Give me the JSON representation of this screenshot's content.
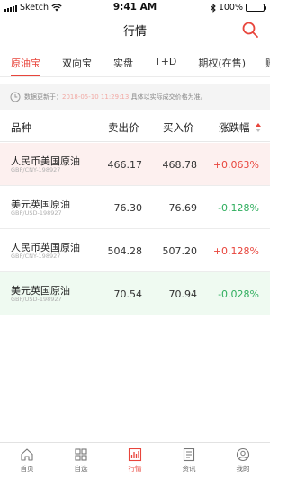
{
  "status_bar": {
    "carrier": "Sketch",
    "time": "9:41 AM",
    "battery": "100%"
  },
  "nav": {
    "title": "行情"
  },
  "tabs": [
    {
      "label": "原油宝",
      "active": true
    },
    {
      "label": "双向宝",
      "active": false
    },
    {
      "label": "实盘",
      "active": false
    },
    {
      "label": "T+D",
      "active": false
    },
    {
      "label": "期权(在售)",
      "active": false
    },
    {
      "label": "账",
      "active": false
    }
  ],
  "notice": {
    "prefix": "数据更新于：",
    "time": "2018-05-10 11:29:13,",
    "suffix": "具体以实际成交价格为准。"
  },
  "table": {
    "headers": {
      "name": "品种",
      "sell": "卖出价",
      "buy": "买入价",
      "change": "涨跌幅"
    },
    "rows": [
      {
        "name": "人民币美国原油",
        "code": "GBP/CNY-198927",
        "sell": "466.17",
        "buy": "468.78",
        "change": "+0.063%",
        "trend": "up"
      },
      {
        "name": "美元英国原油",
        "code": "GBP/USD-198927",
        "sell": "76.30",
        "buy": "76.69",
        "change": "-0.128%",
        "trend": "down"
      },
      {
        "name": "人民币英国原油",
        "code": "GBP/CNY-198927",
        "sell": "504.28",
        "buy": "507.20",
        "change": "+0.128%",
        "trend": "up"
      },
      {
        "name": "美元英国原油",
        "code": "GBP/USD-198927",
        "sell": "70.54",
        "buy": "70.94",
        "change": "-0.028%",
        "trend": "down"
      }
    ]
  },
  "bottom_nav": [
    {
      "label": "首页",
      "icon": "home-icon",
      "active": false
    },
    {
      "label": "自选",
      "icon": "grid-icon",
      "active": false
    },
    {
      "label": "行情",
      "icon": "chart-icon",
      "active": true
    },
    {
      "label": "资讯",
      "icon": "news-icon",
      "active": false
    },
    {
      "label": "我的",
      "icon": "user-icon",
      "active": false
    }
  ],
  "colors": {
    "accent": "#e8453c",
    "down": "#2fae5e",
    "up_row_bg": "#fdf0ef",
    "down_row_bg": "#effaf1"
  }
}
